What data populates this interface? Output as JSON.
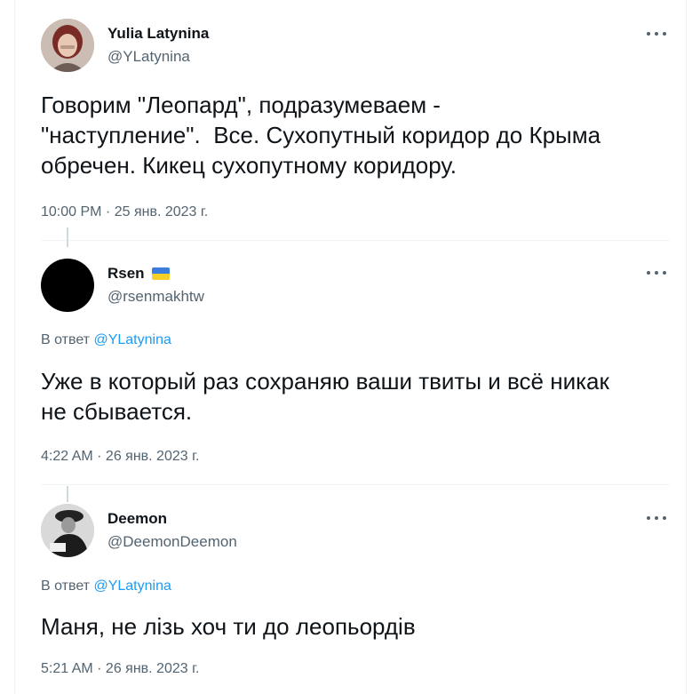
{
  "tweets": [
    {
      "name": "Yulia Latynina",
      "handle": "@YLatynina",
      "text": "Говорим \"Леопард\", подразумеваем -\n\"наступление\".  Все. Сухопутный коридор до Крыма\nобречен. Кикец сухопутному коридору.",
      "time": "10:00 PM · 25 янв. 2023 г.",
      "avatar_icon": "avatar-photo-woman"
    },
    {
      "name": "Rsen",
      "handle": "@rsenmakhtw",
      "flag_icon": "ukraine-flag-icon",
      "reply_prefix": "В ответ ",
      "reply_mention": "@YLatynina",
      "text": "Уже в который раз сохраняю ваши твиты и всё никак\nне сбывается.",
      "time": "4:22 AM · 26 янв. 2023 г.",
      "avatar_icon": "avatar-black"
    },
    {
      "name": "Deemon",
      "handle": "@DeemonDeemon",
      "reply_prefix": "В ответ ",
      "reply_mention": "@YLatynina",
      "text": "Маня, не лізь хоч ти до леопьордів",
      "time": "5:21 AM · 26 янв. 2023 г.",
      "avatar_icon": "avatar-photo-man-bw"
    }
  ],
  "colors": {
    "text": "#0f1419",
    "secondary": "#536471",
    "link": "#1d9bf0",
    "divider": "#eff3f4",
    "thread_line": "#cfd9de"
  }
}
